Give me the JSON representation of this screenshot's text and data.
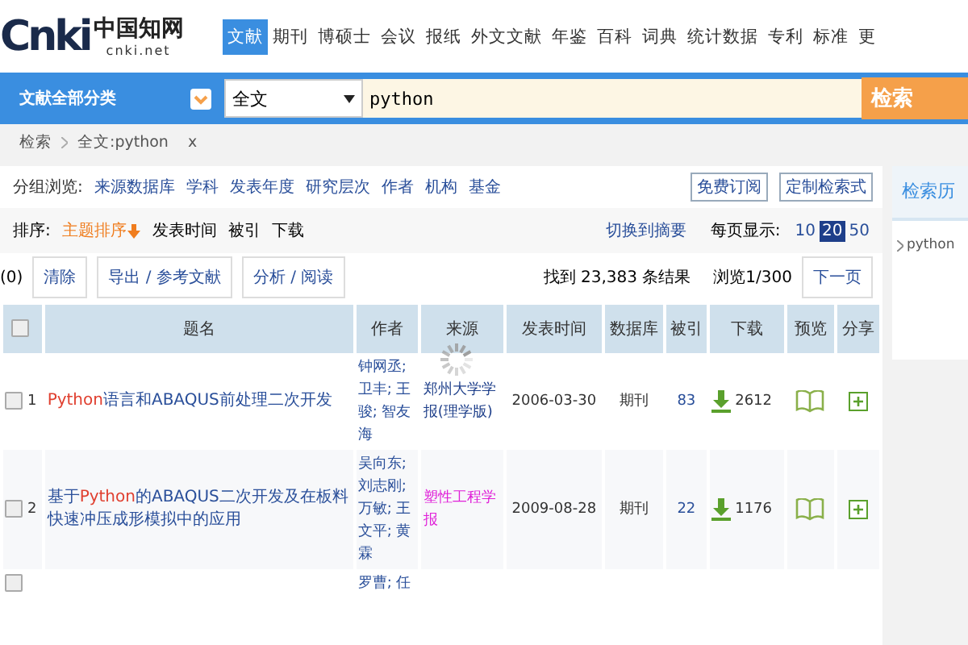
{
  "logo": {
    "mark": "Cnki",
    "name": "中国知网",
    "domain": "cnki.net"
  },
  "nav": [
    {
      "label": "文献",
      "selected": true
    },
    {
      "label": "期刊",
      "selected": false
    },
    {
      "label": "博硕士",
      "selected": false
    },
    {
      "label": "会议",
      "selected": false
    },
    {
      "label": "报纸",
      "selected": false
    },
    {
      "label": "外文文献",
      "selected": false
    },
    {
      "label": "年鉴",
      "selected": false
    },
    {
      "label": "百科",
      "selected": false
    },
    {
      "label": "词典",
      "selected": false
    },
    {
      "label": "统计数据",
      "selected": false
    },
    {
      "label": "专利",
      "selected": false
    },
    {
      "label": "标准",
      "selected": false
    },
    {
      "label": "更",
      "selected": false
    }
  ],
  "search": {
    "category": "文献全部分类",
    "field": "全文",
    "value": "python",
    "button": "检索"
  },
  "breadcrumb": {
    "root": "检索",
    "term": "全文:python",
    "remove": "x"
  },
  "group_browse": {
    "label": "分组浏览:",
    "items": [
      "来源数据库",
      "学科",
      "发表年度",
      "研究层次",
      "作者",
      "机构",
      "基金"
    ],
    "buttons": [
      "免费订阅",
      "定制检索式"
    ]
  },
  "sort": {
    "label": "排序:",
    "items": [
      {
        "label": "主题排序",
        "selected": true
      },
      {
        "label": "发表时间",
        "selected": false
      },
      {
        "label": "被引",
        "selected": false
      },
      {
        "label": "下载",
        "selected": false
      }
    ],
    "switch": "切换到摘要",
    "page_size_label": "每页显示:",
    "page_sizes": [
      {
        "label": "10",
        "selected": false
      },
      {
        "label": "20",
        "selected": true
      },
      {
        "label": "50",
        "selected": false
      }
    ]
  },
  "toolbar": {
    "selected_count": "(0)",
    "buttons": [
      "清除",
      "导出 / 参考文献",
      "分析 / 阅读"
    ],
    "found": "找到 23,383 条结果",
    "page": "浏览1/300",
    "next": "下一页"
  },
  "table": {
    "select_all_checked": false,
    "columns": [
      "题名",
      "作者",
      "来源",
      "发表时间",
      "数据库",
      "被引",
      "下载",
      "预览",
      "分享"
    ],
    "rows": [
      {
        "checked": false,
        "index": "1",
        "title": [
          {
            "text": "Python",
            "highlight": true
          },
          {
            "text": "语言和ABAQUS前处理二次开发",
            "highlight": false
          }
        ],
        "authors": "钟网丞; 卫丰; 王骏; 智友海",
        "source": {
          "text": "郑州大学学报(理学版)",
          "color": "#1e3f8a"
        },
        "date": "2006-03-30",
        "database": "期刊",
        "cited": "83",
        "downloads": "2612",
        "loading": true
      },
      {
        "checked": false,
        "index": "2",
        "title": [
          {
            "text": "基于",
            "highlight": false
          },
          {
            "text": "Python",
            "highlight": true
          },
          {
            "text": "的ABAQUS二次开发及在板料快速冲压成形模拟中的应用",
            "highlight": false
          }
        ],
        "authors": "吴向东; 刘志刚; 万敏; 王文平; 黄霖",
        "source": {
          "text": "塑性工程学报",
          "color": "#e020d8"
        },
        "date": "2009-08-28",
        "database": "期刊",
        "cited": "22",
        "downloads": "1176",
        "loading": false
      },
      {
        "checked": false,
        "authors": "罗曹; 任"
      }
    ]
  },
  "history": {
    "title": "检索历",
    "items": [
      "python"
    ]
  }
}
